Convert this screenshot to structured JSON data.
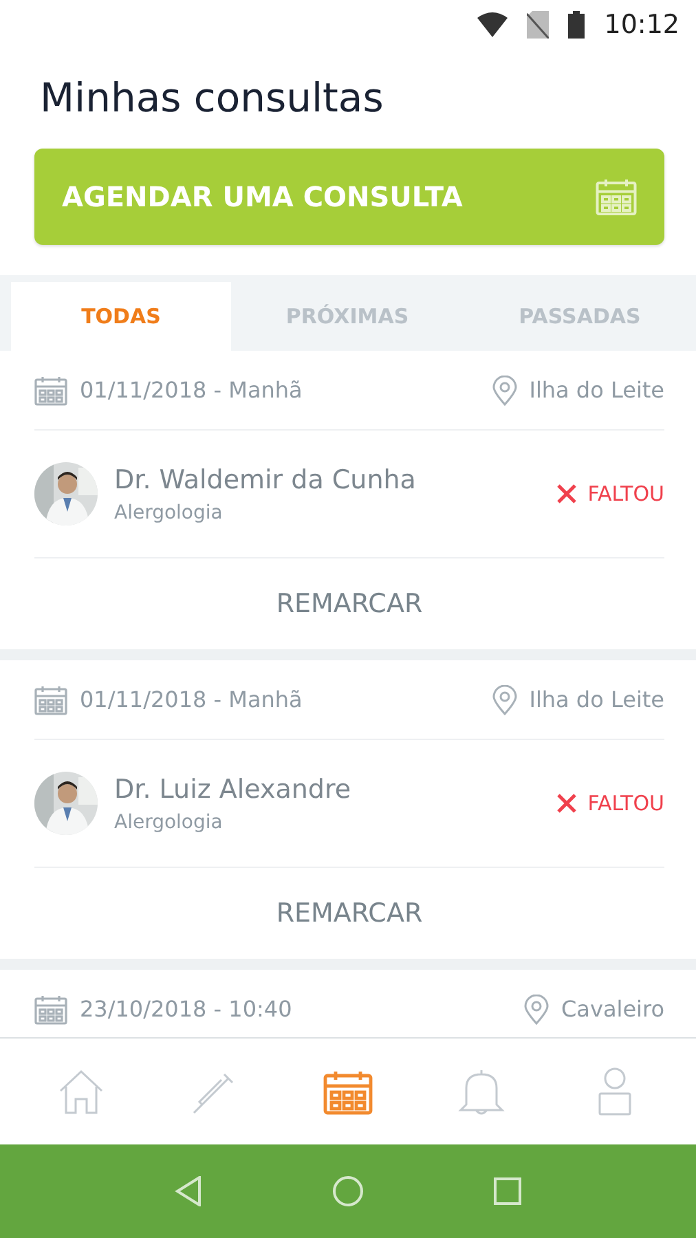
{
  "status_bar": {
    "time": "10:12"
  },
  "title": "Minhas consultas",
  "schedule_button": {
    "label": "AGENDAR UMA CONSULTA"
  },
  "tabs": [
    {
      "label": "TODAS",
      "selected": true
    },
    {
      "label": "PRÓXIMAS",
      "selected": false
    },
    {
      "label": "PASSADAS",
      "selected": false
    }
  ],
  "appointments": [
    {
      "date": "01/11/2018 - Manhã",
      "location": "Ilha do Leite",
      "doctor": "Dr. Waldemir da Cunha",
      "specialty": "Alergologia",
      "status": {
        "kind": "missed",
        "label": "FALTOU"
      },
      "action": "REMARCAR"
    },
    {
      "date": "01/11/2018 - Manhã",
      "location": "Ilha do Leite",
      "doctor": "Dr. Luiz Alexandre",
      "specialty": "Alergologia",
      "status": {
        "kind": "missed",
        "label": "FALTOU"
      },
      "action": "REMARCAR"
    },
    {
      "date": "23/10/2018 - 10:40",
      "location": "Cavaleiro"
    }
  ],
  "bottom_nav": [
    {
      "kind": "home",
      "selected": false
    },
    {
      "kind": "syringe",
      "selected": false
    },
    {
      "kind": "calendar",
      "selected": true
    },
    {
      "kind": "bell",
      "selected": false
    },
    {
      "kind": "profile",
      "selected": false
    }
  ]
}
